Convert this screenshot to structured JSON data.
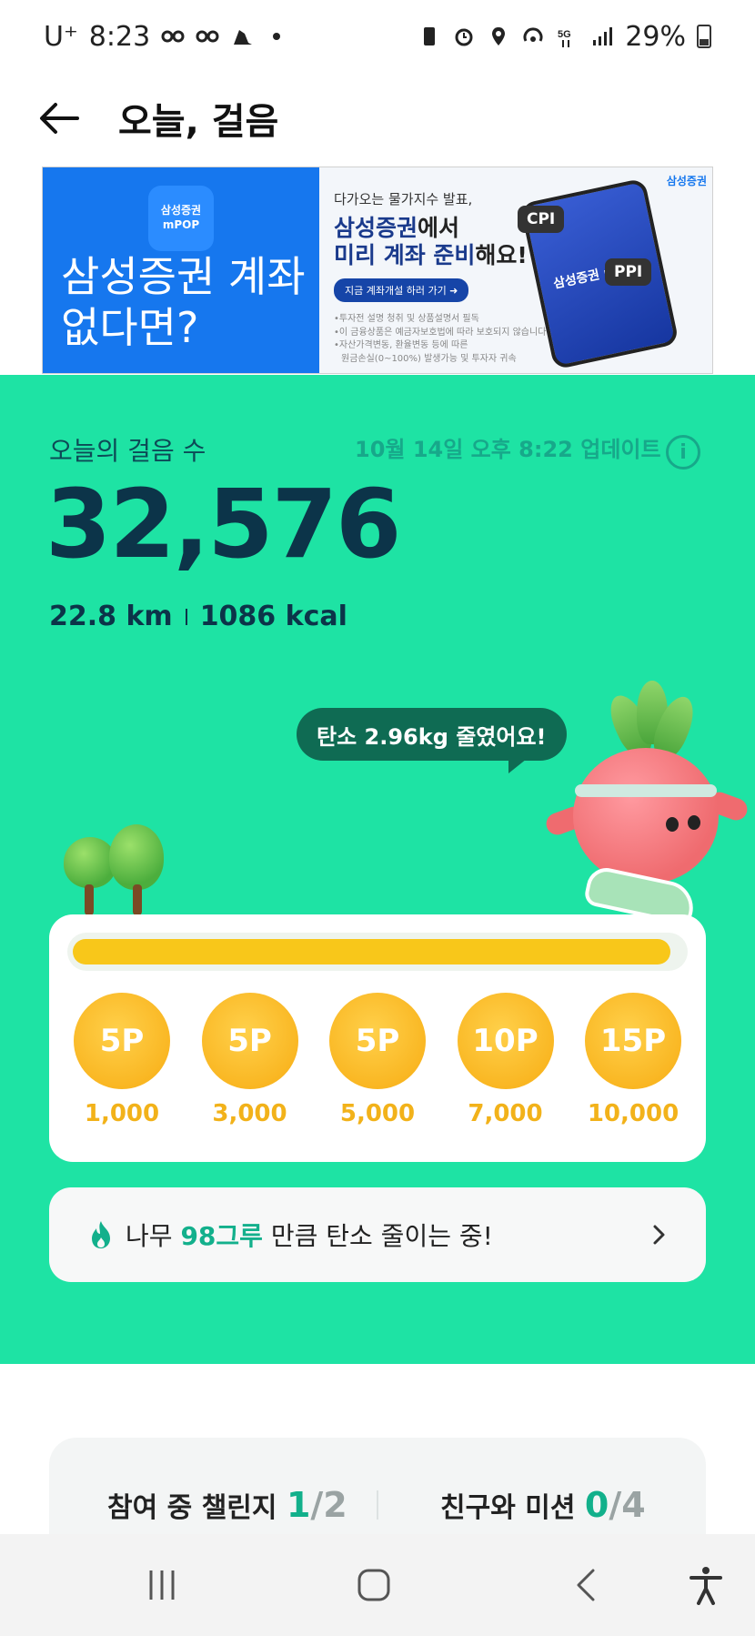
{
  "status_bar": {
    "carrier": "U⁺",
    "time": "8:23",
    "battery": "29%"
  },
  "app_bar": {
    "title": "오늘, 걸음"
  },
  "ad": {
    "logo_line1": "삼성증권",
    "logo_line2": "mPOP",
    "headline": "삼성증권 계좌 없다면?",
    "sub": "다가오는 물가지수 발표,",
    "main_line1_brand": "삼성증권",
    "main_line1_rest": "에서",
    "main_line2_blue": "미리 계좌 준비",
    "main_line2_rest": "해요!",
    "cta": "지금 계좌개설 하러 가기 ➜",
    "note1": "•투자전 설명 청취 및 상품설명서 필독",
    "note2": "•이 금융상품은 예금자보호법에 따라 보호되지 않습니다",
    "note3": "•자산가격변동, 환율변동 등에 따른",
    "note4": "원금손실(0~100%) 발생가능 및 투자자 귀속",
    "tag_cpi": "CPI",
    "tag_ppi": "PPI",
    "phone_text": "삼성증권 mPOP",
    "corner_label": "삼성증권"
  },
  "steps": {
    "label": "오늘의 걸음 수",
    "updated": "10월 14일 오후 8:22 업데이트",
    "count": "32,576",
    "distance": "22.8 km",
    "calories": "1086 kcal",
    "speech": "탄소 2.96kg 줄였어요!",
    "progress_fraction": 0.98
  },
  "rewards": [
    {
      "points": "5P",
      "steps": "1,000"
    },
    {
      "points": "5P",
      "steps": "3,000"
    },
    {
      "points": "5P",
      "steps": "5,000"
    },
    {
      "points": "10P",
      "steps": "7,000"
    },
    {
      "points": "15P",
      "steps": "10,000"
    }
  ],
  "carbon": {
    "prefix": "나무",
    "highlight": "98그루",
    "suffix": "만큼 탄소 줄이는 중!"
  },
  "challenges": {
    "joined_label": "참여 중 챌린지",
    "joined_count": "1",
    "joined_total": "/2",
    "friends_label": "친구와 미션",
    "friends_count": "0",
    "friends_total": "/4"
  },
  "colors": {
    "brand_green": "#1ee3a4",
    "dark_green": "#0f6b53",
    "accent_teal": "#13b08c",
    "coin_gold": "#f9b520",
    "progress_yellow": "#f8c71a"
  },
  "icons": {
    "back": "arrow-left-icon",
    "info": "info-icon",
    "flame": "flame-icon",
    "chevron": "chevron-right-icon",
    "nav_recent": "recent-apps-icon",
    "nav_home": "home-icon",
    "nav_back": "back-icon",
    "nav_accessibility": "accessibility-icon"
  }
}
